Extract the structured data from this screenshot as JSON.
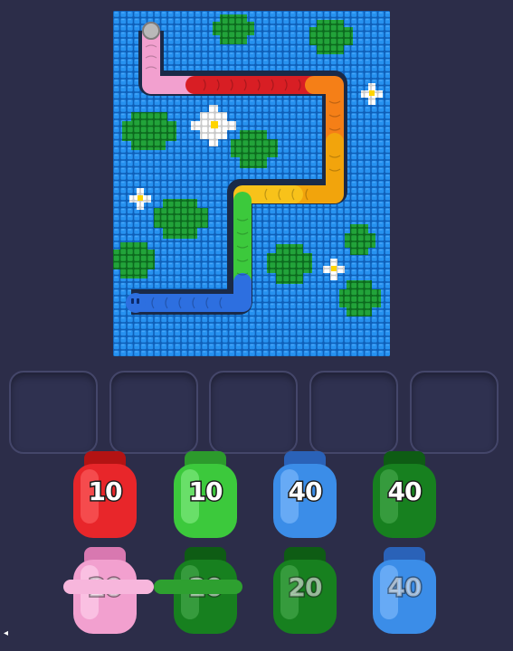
{
  "colors": {
    "background": "#2c2d49",
    "water": "#1e86e8",
    "lily_pad": "#1f9a3a",
    "red": "#e8262a",
    "green": "#3cc93c",
    "blue": "#3b8de8",
    "dark_green": "#17801f",
    "pink": "#f2a0cf"
  },
  "board": {
    "snake_colors": [
      "pink",
      "red",
      "orange",
      "yellow",
      "green",
      "blue"
    ]
  },
  "slots": {
    "count": 5
  },
  "jars": [
    {
      "row": 1,
      "color": "red",
      "value": "10"
    },
    {
      "row": 1,
      "color": "green",
      "value": "10"
    },
    {
      "row": 1,
      "color": "blue",
      "value": "40"
    },
    {
      "row": 1,
      "color": "dark_green",
      "value": "40"
    },
    {
      "row": 2,
      "color": "pink",
      "value": "20"
    },
    {
      "row": 2,
      "color": "dark_green",
      "value": "20"
    },
    {
      "row": 2,
      "color": "dark_green",
      "value": "20"
    },
    {
      "row": 2,
      "color": "blue",
      "value": "40"
    }
  ]
}
